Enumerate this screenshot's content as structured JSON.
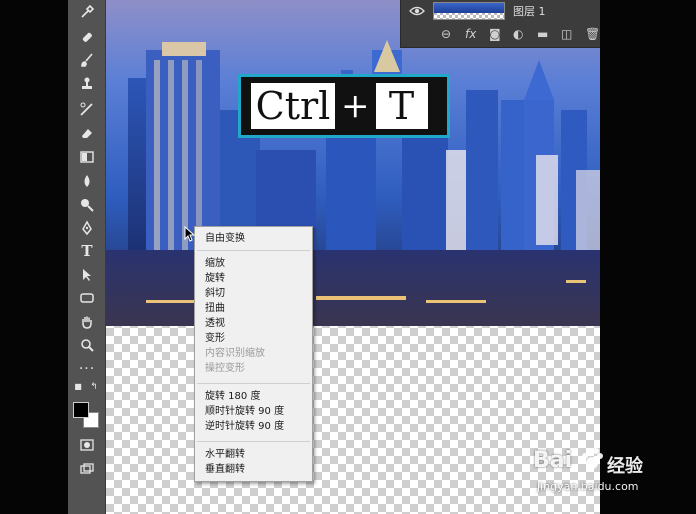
{
  "overlay": {
    "key1": "Ctrl",
    "plus": "+",
    "key2": "T"
  },
  "layers_panel": {
    "layer_name": "图层 1",
    "icons": [
      "link-icon",
      "fx-icon",
      "mask-icon",
      "adjustment-icon",
      "folder-icon",
      "new-layer-icon",
      "trash-icon"
    ],
    "fx_label": "fx"
  },
  "context_menu": {
    "items": [
      {
        "label": "自由变换",
        "enabled": true
      },
      {
        "label": "缩放",
        "enabled": true
      },
      {
        "label": "旋转",
        "enabled": true
      },
      {
        "label": "斜切",
        "enabled": true
      },
      {
        "label": "扭曲",
        "enabled": true
      },
      {
        "label": "透视",
        "enabled": true
      },
      {
        "label": "变形",
        "enabled": true
      },
      {
        "label": "内容识别缩放",
        "enabled": false
      },
      {
        "label": "操控变形",
        "enabled": false
      },
      {
        "label": "旋转 180 度",
        "enabled": true
      },
      {
        "label": "顺时针旋转 90 度",
        "enabled": true
      },
      {
        "label": "逆时针旋转 90 度",
        "enabled": true
      },
      {
        "label": "水平翻转",
        "enabled": true
      },
      {
        "label": "垂直翻转",
        "enabled": true
      }
    ]
  },
  "toolbar": {
    "tools": [
      "eyedropper-icon",
      "healing-brush-icon",
      "brush-icon",
      "clone-stamp-icon",
      "history-brush-icon",
      "eraser-icon",
      "gradient-icon",
      "blur-icon",
      "dodge-icon",
      "pen-icon",
      "type-icon",
      "path-select-icon",
      "shape-icon",
      "hand-icon",
      "zoom-icon",
      "more-icon"
    ],
    "type_glyph": "T",
    "foreground_color": "#000000",
    "background_color": "#ffffff"
  },
  "watermark": {
    "brand": "Bai",
    "sub": "经验",
    "url": "jingyan.baidu.com"
  },
  "colors": {
    "accent_border": "#1fa8c8",
    "toolbar_bg": "#535353",
    "menu_bg": "#f0f0f0"
  }
}
